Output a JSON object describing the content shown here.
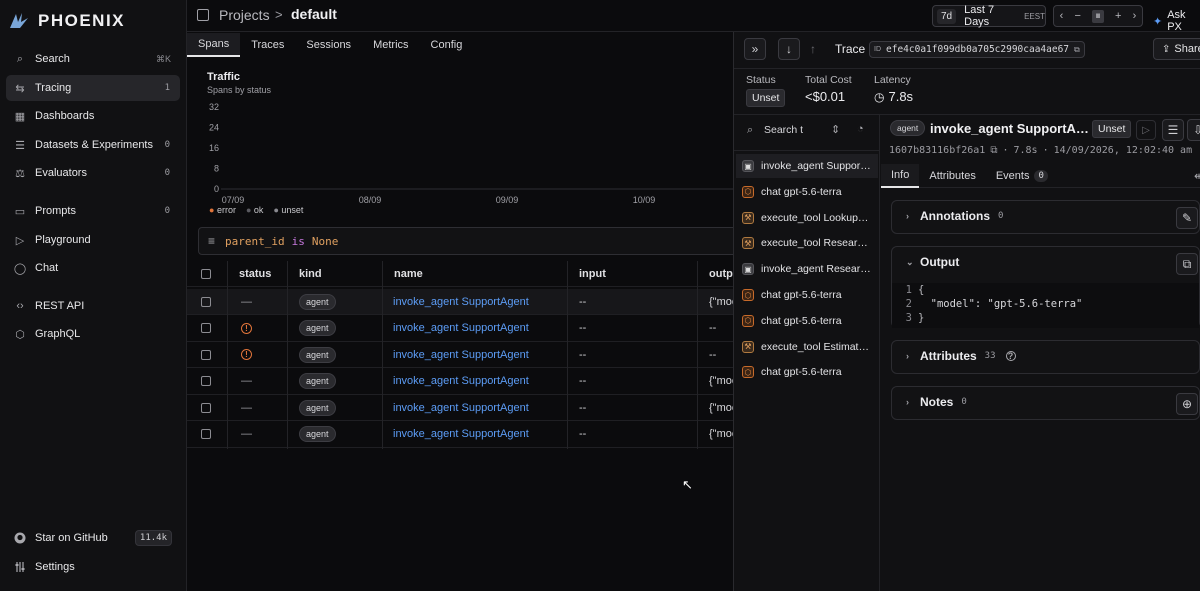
{
  "app": {
    "name": "PHOENIX"
  },
  "sidebar": {
    "items": [
      {
        "label": "Search",
        "icon": "search-icon",
        "shortcut": "⌘K"
      },
      {
        "label": "Tracing",
        "icon": "tracing-icon",
        "count": "1"
      },
      {
        "label": "Dashboards",
        "icon": "grid-icon"
      },
      {
        "label": "Datasets & Experiments",
        "icon": "database-icon",
        "count": "0"
      },
      {
        "label": "Evaluators",
        "icon": "scale-icon",
        "count": "0"
      },
      {
        "label": "Prompts",
        "icon": "chat-icon",
        "count": "0"
      },
      {
        "label": "Playground",
        "icon": "play-icon"
      },
      {
        "label": "Chat",
        "icon": "bubble-icon"
      },
      {
        "label": "REST API",
        "icon": "code-icon"
      },
      {
        "label": "GraphQL",
        "icon": "graphql-icon"
      }
    ],
    "github": {
      "label": "Star on GitHub",
      "stars": "11.4k"
    },
    "settings": "Settings"
  },
  "header": {
    "projects": "Projects",
    "sep": ">",
    "project": "default",
    "range_badge": "7d",
    "range_label": "Last 7 Days",
    "tz": "EEST",
    "ask": "Ask PX"
  },
  "tabs": [
    "Spans",
    "Traces",
    "Sessions",
    "Metrics",
    "Config"
  ],
  "traffic": {
    "title": "Traffic",
    "subtitle": "Spans by status",
    "legend": [
      {
        "name": "error",
        "color": "#e0743a"
      },
      {
        "name": "ok",
        "color": "#5a5a60"
      },
      {
        "name": "unset",
        "color": "#8a8a90"
      }
    ]
  },
  "chart_data": {
    "type": "bar",
    "title": "Traffic",
    "subtitle": "Spans by status",
    "categories": [
      "07/09",
      "08/09",
      "09/09",
      "10/09"
    ],
    "yticks": [
      "32",
      "24",
      "16",
      "8",
      "0"
    ],
    "ylim": [
      0,
      32
    ],
    "series": [
      {
        "name": "error",
        "values": [
          0,
          0,
          0,
          0
        ]
      },
      {
        "name": "ok",
        "values": [
          0,
          0,
          0,
          0
        ]
      },
      {
        "name": "unset",
        "values": [
          0,
          0,
          0,
          0
        ]
      }
    ]
  },
  "filter": {
    "field": "parent_id",
    "op": "is",
    "value": "None"
  },
  "table": {
    "columns": [
      "status",
      "kind",
      "name",
      "input",
      "outp"
    ],
    "rows": [
      {
        "status": "—",
        "kind": "agent",
        "name": "invoke_agent SupportAgent",
        "input": "--",
        "output": "{\"moc"
      },
      {
        "status": "!",
        "kind": "agent",
        "name": "invoke_agent SupportAgent",
        "input": "--",
        "output": "--"
      },
      {
        "status": "!",
        "kind": "agent",
        "name": "invoke_agent SupportAgent",
        "input": "--",
        "output": "--"
      },
      {
        "status": "—",
        "kind": "agent",
        "name": "invoke_agent SupportAgent",
        "input": "--",
        "output": "{\"moc"
      },
      {
        "status": "—",
        "kind": "agent",
        "name": "invoke_agent SupportAgent",
        "input": "--",
        "output": "{\"moc"
      },
      {
        "status": "—",
        "kind": "agent",
        "name": "invoke_agent SupportAgent",
        "input": "--",
        "output": "{\"moc"
      }
    ]
  },
  "trace": {
    "title": "Trace",
    "id_label": "ID",
    "id": "efe4c0a1f099db0a705c2990caa4ae67",
    "share": "Share",
    "status_label": "Status",
    "status_value": "Unset",
    "cost_label": "Total Cost",
    "cost_value": "<$0.01",
    "latency_label": "Latency",
    "latency_value": "7.8s",
    "search_placeholder": "Search t",
    "spans": [
      {
        "label": "invoke_agent Suppor…",
        "kind": "agent"
      },
      {
        "label": "chat gpt-5.6-terra",
        "kind": "llm"
      },
      {
        "label": "execute_tool Lookup…",
        "kind": "tool"
      },
      {
        "label": "execute_tool Resear…",
        "kind": "tool"
      },
      {
        "label": "invoke_agent Resear…",
        "kind": "agent"
      },
      {
        "label": "chat gpt-5.6-terra",
        "kind": "llm"
      },
      {
        "label": "chat gpt-5.6-terra",
        "kind": "llm"
      },
      {
        "label": "execute_tool Estimat…",
        "kind": "tool"
      },
      {
        "label": "chat gpt-5.6-terra",
        "kind": "llm"
      }
    ],
    "detail": {
      "kind": "agent",
      "name": "invoke_agent SupportA…",
      "status": "Unset",
      "span_id": "1607b83116bf26a1",
      "latency": "7.8s",
      "sep": "·",
      "timestamp": "14/09/2026, 12:02:40 am",
      "tabs": [
        {
          "label": "Info"
        },
        {
          "label": "Attributes"
        },
        {
          "label": "Events",
          "count": "0"
        }
      ],
      "annotations": {
        "label": "Annotations",
        "count": "0"
      },
      "output": {
        "label": "Output",
        "lines": [
          "{",
          "  \"model\": \"gpt-5.6-terra\"",
          "}"
        ],
        "line_numbers": [
          "1",
          "2",
          "3"
        ]
      },
      "attributes": {
        "label": "Attributes",
        "count": "33"
      },
      "notes": {
        "label": "Notes",
        "count": "0"
      }
    }
  }
}
